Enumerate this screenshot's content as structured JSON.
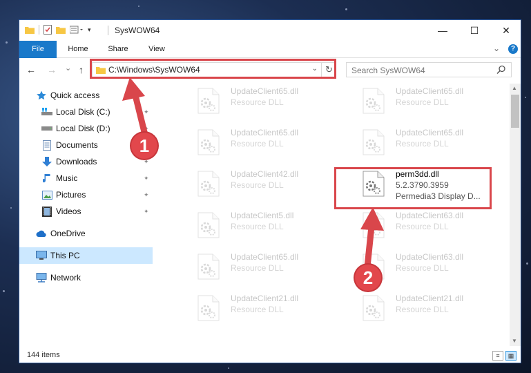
{
  "window": {
    "title": "SysWOW64",
    "controls": {
      "minimize": "—",
      "maximize": "☐",
      "close": "✕"
    }
  },
  "ribbon": {
    "tabs": [
      "File",
      "Home",
      "Share",
      "View"
    ],
    "expand_glyph": "⌄",
    "help_glyph": "?"
  },
  "nav": {
    "back": "←",
    "forward": "→",
    "recent": "⌄",
    "up": "↑",
    "address": "C:\\Windows\\SysWOW64",
    "address_dropdown": "⌄",
    "refresh": "↻",
    "search_placeholder": "Search SysWOW64"
  },
  "sidebar": {
    "items": [
      {
        "label": "Quick access",
        "icon": "star-icon",
        "pinned": false
      },
      {
        "label": "Local Disk (C:)",
        "icon": "windows-drive-icon",
        "pinned": true
      },
      {
        "label": "Local Disk (D:)",
        "icon": "drive-icon",
        "pinned": true
      },
      {
        "label": "Documents",
        "icon": "documents-icon",
        "pinned": true
      },
      {
        "label": "Downloads",
        "icon": "download-arrow-icon",
        "pinned": true
      },
      {
        "label": "Music",
        "icon": "music-note-icon",
        "pinned": true
      },
      {
        "label": "Pictures",
        "icon": "pictures-icon",
        "pinned": true
      },
      {
        "label": "Videos",
        "icon": "film-icon",
        "pinned": true
      },
      {
        "label": "OneDrive",
        "icon": "cloud-icon",
        "pinned": false
      },
      {
        "label": "This PC",
        "icon": "monitor-icon",
        "pinned": false,
        "selected": true
      },
      {
        "label": "Network",
        "icon": "network-icon",
        "pinned": false
      }
    ],
    "pin_glyph": "📌"
  },
  "files": [
    {
      "name": "UpdateClient65.dll",
      "sub1": "Resource DLL",
      "sub2": "",
      "faded": true
    },
    {
      "name": "UpdateClient65.dll",
      "sub1": "Resource DLL",
      "sub2": "",
      "faded": true
    },
    {
      "name": "UpdateClient65.dll",
      "sub1": "Resource DLL",
      "sub2": "",
      "faded": true
    },
    {
      "name": "UpdateClient65.dll",
      "sub1": "Resource DLL",
      "sub2": "",
      "faded": true
    },
    {
      "name": "UpdateClient42.dll",
      "sub1": "Resource DLL",
      "sub2": "",
      "faded": true
    },
    {
      "name": "perm3dd.dll",
      "sub1": "5.2.3790.3959",
      "sub2": "Permedia3 Display D...",
      "faded": false
    },
    {
      "name": "UpdateClient5.dll",
      "sub1": "Resource DLL",
      "sub2": "",
      "faded": true
    },
    {
      "name": "UpdateClient63.dll",
      "sub1": "Resource DLL",
      "sub2": "",
      "faded": true
    },
    {
      "name": "UpdateClient65.dll",
      "sub1": "Resource DLL",
      "sub2": "",
      "faded": true
    },
    {
      "name": "UpdateClient63.dll",
      "sub1": "Resource DLL",
      "sub2": "",
      "faded": true
    },
    {
      "name": "UpdateClient21.dll",
      "sub1": "Resource DLL",
      "sub2": "",
      "faded": true
    },
    {
      "name": "UpdateClient21.dll",
      "sub1": "Resource DLL",
      "sub2": "",
      "faded": true
    }
  ],
  "status": {
    "item_count": "144 items"
  },
  "annotations": {
    "step1": "1",
    "step2": "2",
    "highlight_color": "#d9464b"
  },
  "colors": {
    "file_tab": "#1979ca",
    "selected_nav": "#cce8ff"
  }
}
